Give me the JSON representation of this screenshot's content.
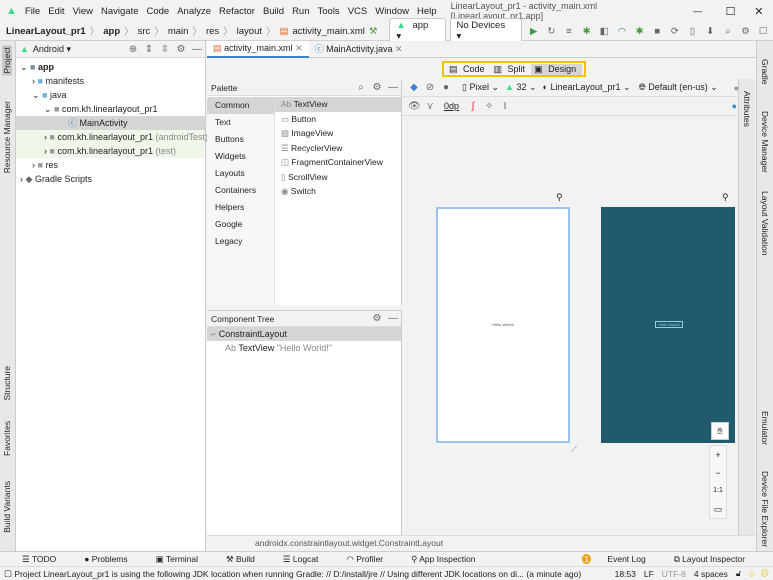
{
  "menu": [
    "File",
    "Edit",
    "View",
    "Navigate",
    "Code",
    "Analyze",
    "Refactor",
    "Build",
    "Run",
    "Tools",
    "VCS",
    "Window",
    "Help"
  ],
  "window_title": "LinearLayout_pr1 - activity_main.xml [LinearLayout_pr1.app]",
  "breadcrumb": [
    "LinearLayout_pr1",
    "app",
    "src",
    "main",
    "res",
    "layout",
    "activity_main.xml"
  ],
  "run_config": "app",
  "device_select": "No Devices",
  "left_strip": [
    "Project",
    "Resource Manager",
    "Structure",
    "Favorites",
    "Build Variants"
  ],
  "right_strip": [
    "Gradle",
    "Device Manager",
    "Layout Validation",
    "Emulator",
    "Device File Explorer"
  ],
  "project": {
    "view": "Android",
    "tree": [
      {
        "label": "app",
        "suffix": ""
      },
      {
        "label": "manifests",
        "suffix": ""
      },
      {
        "label": "java",
        "suffix": ""
      },
      {
        "label": "com.kh.linearlayout_pr1",
        "suffix": ""
      },
      {
        "label": "MainActivity",
        "suffix": ""
      },
      {
        "label": "com.kh.linearlayout_pr1",
        "suffix": "(androidTest)"
      },
      {
        "label": "com.kh.linearlayout_pr1",
        "suffix": "(test)"
      },
      {
        "label": "res",
        "suffix": ""
      },
      {
        "label": "Gradle Scripts",
        "suffix": ""
      }
    ]
  },
  "tabs": [
    "activity_main.xml",
    "MainActivity.java"
  ],
  "modes": [
    "Code",
    "Split",
    "Design"
  ],
  "palette": {
    "title": "Palette",
    "categories": [
      "Common",
      "Text",
      "Buttons",
      "Widgets",
      "Layouts",
      "Containers",
      "Helpers",
      "Google",
      "Legacy"
    ],
    "items": [
      "TextView",
      "Button",
      "ImageView",
      "RecyclerView",
      "FragmentContainerView",
      "ScrollView",
      "Switch"
    ]
  },
  "component_tree": {
    "title": "Component Tree",
    "root": "ConstraintLayout",
    "child": "TextView",
    "child_text": "\"Hello World!\""
  },
  "toolbar": {
    "device": "Pixel",
    "api": "32",
    "theme": "LinearLayout_pr1",
    "locale": "Default (en-us)",
    "margin": "0dp"
  },
  "canvas": {
    "design_text": "Hello World!",
    "blueprint_text": "Hello World!",
    "zoom_fit": "1:1",
    "blueprint_color": "#215a6d"
  },
  "path": "androidx.constraintlayout.widget.ConstraintLayout",
  "tool_windows": [
    "TODO",
    "Problems",
    "Terminal",
    "Build",
    "Logcat",
    "Profiler",
    "App Inspection"
  ],
  "tool_windows_right": [
    "Event Log",
    "Layout Inspector"
  ],
  "event_count": "1",
  "status": {
    "message": "Project LinearLayout_pr1 is using the following JDK location when running Gradle: // D:/install/jre // Using different JDK locations on di... (a minute ago)",
    "time": "18:53",
    "line_sep": "LF",
    "encoding": "UTF-8",
    "indent": "4 spaces"
  }
}
